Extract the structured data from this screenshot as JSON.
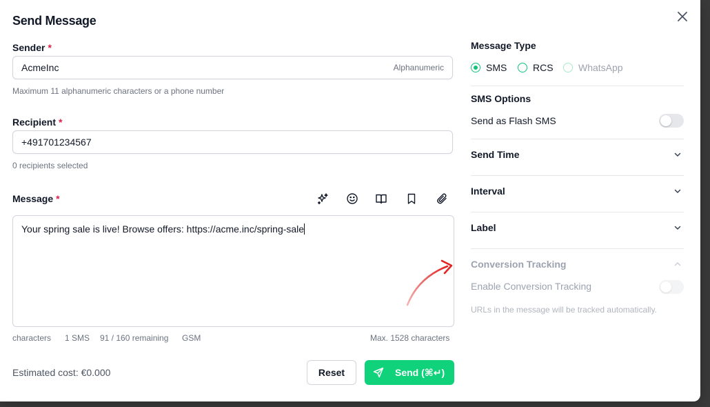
{
  "title": "Send Message",
  "sender": {
    "label": "Sender",
    "required_mark": "*",
    "value": "AcmeInc",
    "suffix": "Alphanumeric",
    "help": "Maximum 11 alphanumeric characters or a phone number"
  },
  "recipient": {
    "label": "Recipient",
    "required_mark": "*",
    "value": "+491701234567",
    "help": "0 recipients selected"
  },
  "message": {
    "label": "Message",
    "required_mark": "*",
    "tools": [
      "sparkles-icon",
      "emoji-icon",
      "book-icon",
      "bookmark-icon",
      "paperclip-icon"
    ],
    "text": "Your spring sale is live! Browse offers: https://acme.inc/spring-sale",
    "stats": {
      "characters": "characters",
      "sms": "1 SMS",
      "remaining": "91 / 160 remaining",
      "encoding": "GSM",
      "max": "Max. 1528 characters"
    }
  },
  "footer": {
    "cost": "Estimated cost: €0.000",
    "reset_label": "Reset",
    "send_label": "Send (⌘↵)"
  },
  "message_type": {
    "label": "Message Type",
    "options": [
      {
        "label": "SMS",
        "checked": true
      },
      {
        "label": "RCS",
        "checked": false
      },
      {
        "label": "WhatsApp",
        "checked": false,
        "disabled": true
      }
    ]
  },
  "sms_options": {
    "label": "SMS Options",
    "flash_label": "Send as Flash SMS",
    "flash_on": false
  },
  "sections": {
    "send_time": "Send Time",
    "interval": "Interval",
    "label": "Label"
  },
  "conversion": {
    "label": "Conversion Tracking",
    "enable_label": "Enable Conversion Tracking",
    "note": "URLs in the message will be tracked automatically."
  },
  "colors": {
    "accent": "#10d27a",
    "required": "#e11d48",
    "annotation_arrow": "#e53e3e"
  }
}
